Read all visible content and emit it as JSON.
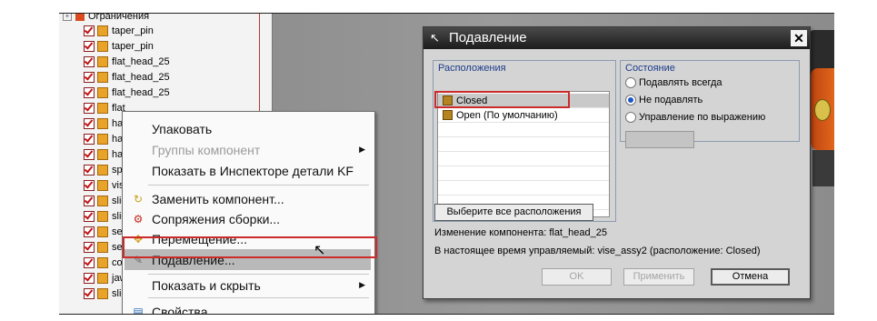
{
  "tree": {
    "top_item": "Ограничения",
    "rows": [
      "taper_pin",
      "taper_pin",
      "flat_head_25",
      "flat_head_25",
      "flat_head_25",
      "flat",
      "har",
      "har",
      "har",
      "spe",
      "vise",
      "slic",
      "slic",
      "set",
      "set",
      "col",
      "jaw",
      "slic"
    ]
  },
  "context_menu": {
    "items": [
      {
        "label": "Упаковать",
        "icon": "",
        "disabled": false,
        "arrow": false
      },
      {
        "label": "Группы компонент",
        "icon": "",
        "disabled": true,
        "arrow": true
      },
      {
        "label": "Показать в Инспекторе детали KF",
        "icon": "",
        "disabled": false,
        "arrow": false
      },
      {
        "label": "Заменить компонент...",
        "icon": "replace-icon",
        "disabled": false,
        "arrow": false
      },
      {
        "label": "Сопряжения сборки...",
        "icon": "mates-icon",
        "disabled": false,
        "arrow": false
      },
      {
        "label": "Перемещение...",
        "icon": "move-icon",
        "disabled": false,
        "arrow": false
      },
      {
        "label": "Подавление...",
        "icon": "suppress-icon",
        "disabled": false,
        "arrow": false,
        "highlighted": true
      },
      {
        "label": "Показать и скрыть",
        "icon": "",
        "disabled": false,
        "arrow": true
      },
      {
        "label": "Свойства",
        "icon": "properties-icon",
        "disabled": false,
        "arrow": false
      }
    ]
  },
  "dialog": {
    "title": "Подавление",
    "close": "✕",
    "arrangements_label": "Расположения",
    "arrangements": [
      "Closed",
      "Open (По умолчанию)"
    ],
    "selected_arrangement": "Closed",
    "state_label": "Состояние",
    "states": [
      "Подавлять всегда",
      "Не подавлять",
      "Управление по выражению"
    ],
    "selected_state": "Не подавлять",
    "select_all_button": "Выберите все расположения",
    "component_change": "Изменение компонента: flat_head_25",
    "controlled_by": "В настоящее время управляемый: vise_assy2 (расположение: Closed)",
    "ok": "OK",
    "apply": "Применить",
    "cancel": "Отмена"
  },
  "colors": {
    "highlight_outline": "#cc2b2b",
    "title_bar": "#1c1c1c",
    "group_label": "#1d3c8c"
  }
}
